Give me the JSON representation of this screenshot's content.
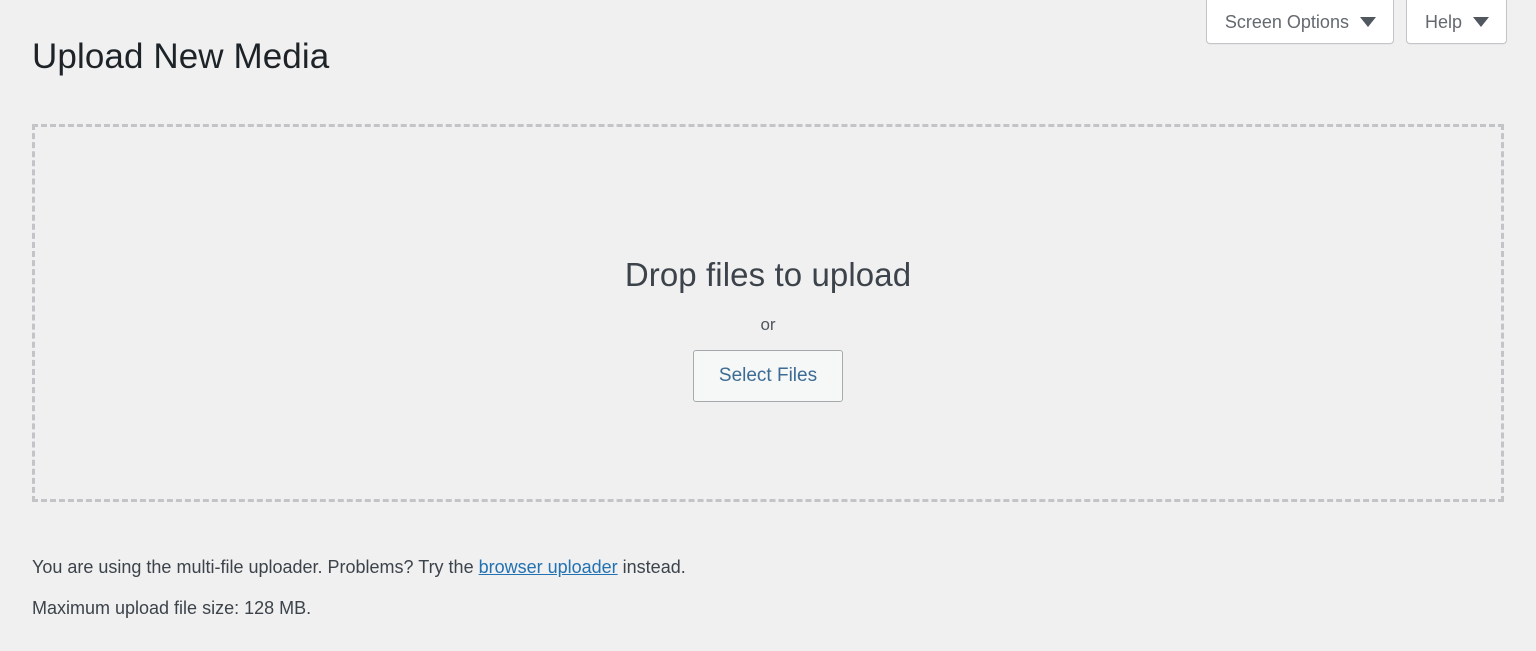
{
  "screen_meta": {
    "buttons": [
      {
        "label": "Screen Options",
        "icon": "chevron-down-icon"
      },
      {
        "label": "Help",
        "icon": "chevron-down-icon"
      }
    ]
  },
  "page": {
    "title": "Upload New Media"
  },
  "uploader": {
    "drop_title": "Drop files to upload",
    "or_label": "or",
    "select_files_label": "Select Files"
  },
  "notices": {
    "bypass_prefix": "You are using the multi-file uploader. Problems? Try the ",
    "bypass_link": "browser uploader",
    "bypass_suffix": " instead.",
    "max_upload_size": "Maximum upload file size: 128 MB."
  },
  "colors": {
    "page_background": "#f0f0f1",
    "text": "#3c434a",
    "heading": "#1d2327",
    "link": "#2271b1",
    "dashed_border": "#c3c4c7",
    "button_border": "#a7aaad",
    "button_text": "#3c6c94"
  }
}
